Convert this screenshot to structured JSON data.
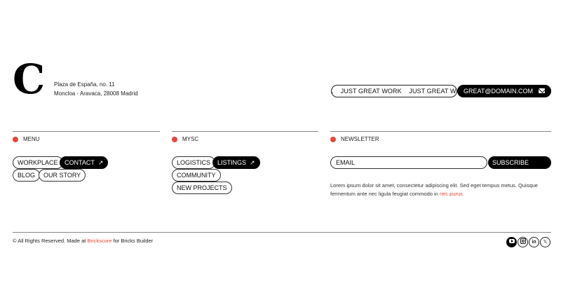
{
  "brand": {
    "logo_letter": "C"
  },
  "address": {
    "line1": "Plaza de España, no. 11",
    "line2": "Moncloa - Aravaca, 28008 Madrid"
  },
  "marquee": {
    "items": [
      "K",
      "JUST GREAT WORK",
      "JUST GREAT WORK"
    ]
  },
  "contact": {
    "email": "GREAT@DOMAIN.COM",
    "icon": "mail-icon"
  },
  "menu": {
    "label": "MENU",
    "links": [
      "WORKPLACE",
      "CONTACT",
      "BLOG",
      "OUR STORY"
    ]
  },
  "mysc": {
    "label": "MYSC",
    "links": [
      "LOGISTICS",
      "LISTINGS",
      "COMMUNITY",
      "NEW PROJECTS"
    ]
  },
  "newsletter": {
    "label": "NEWSLETTER",
    "email_value": "EMAIL",
    "subscribe_label": "SUBSCRIBE",
    "text": "Lorem ipsum dolor sit amet, consectetur adipiscing elit. Sed eget tempus metus. Quisque fermentum ante nec ligula feugiat commodo in",
    "link_text": "nec purus"
  },
  "footer": {
    "copyright_prefix": "© All Rights Reserved. Made at",
    "brand_link": "Brickscore",
    "copyright_suffix": "for Bricks Builder",
    "social": [
      "youtube-icon",
      "instagram-icon",
      "linkedin-icon",
      "x-icon"
    ],
    "linkedin_text": "in",
    "x_text": "𝕏"
  },
  "colors": {
    "accent": "#e8463a",
    "dark": "#000000"
  }
}
